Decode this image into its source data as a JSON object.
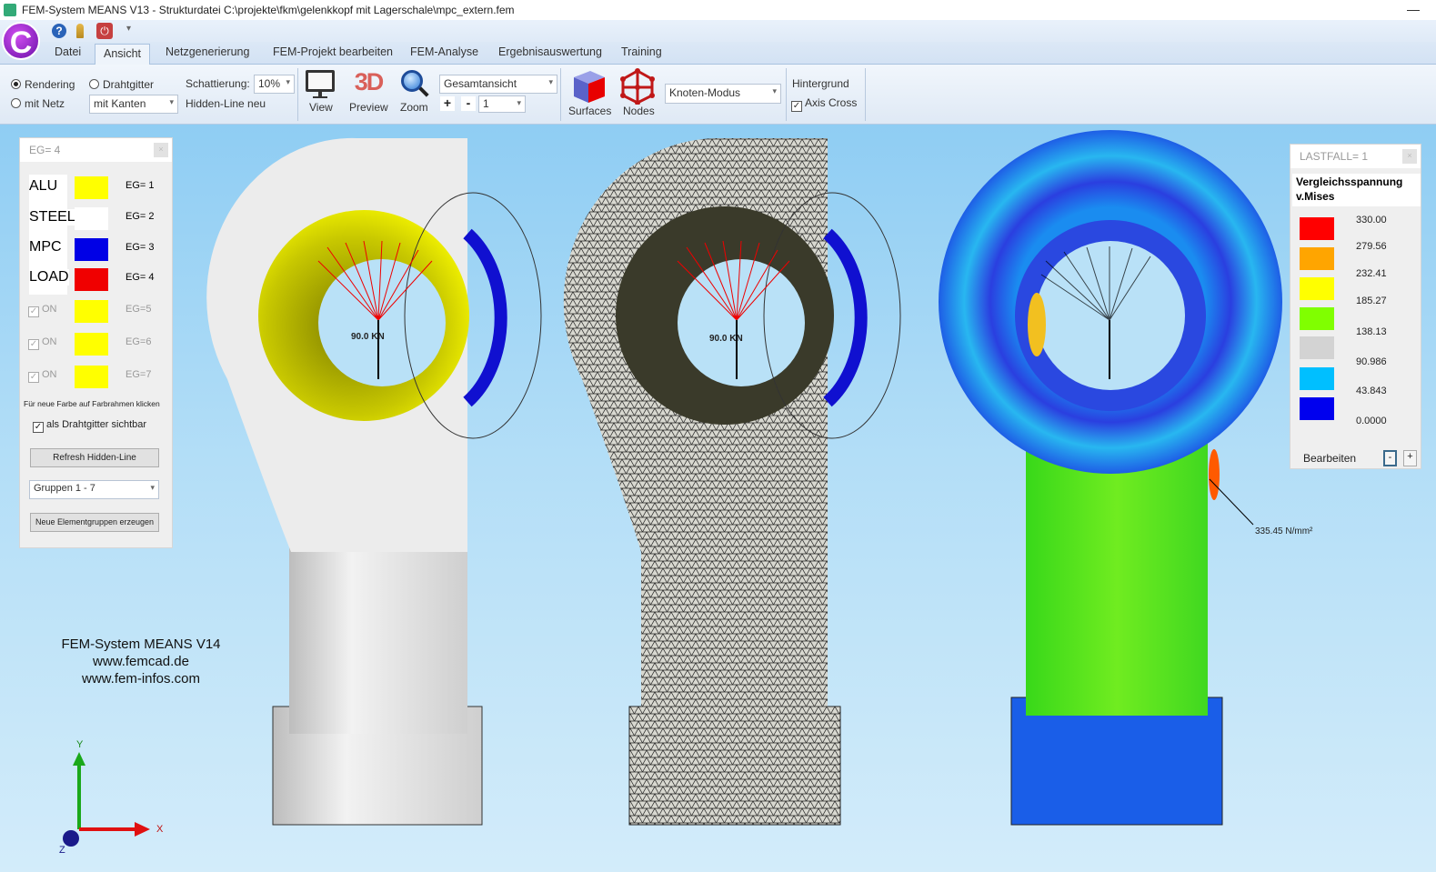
{
  "window": {
    "title": "FEM-System MEANS V13 - Strukturdatei C:\\projekte\\fkm\\gelenkkopf mit Lagerschale\\mpc_extern.fem",
    "minimize": "—"
  },
  "quick_access": {
    "logo": "C",
    "icons": [
      "help-icon",
      "key-icon",
      "power-icon"
    ],
    "more": "▾"
  },
  "tabs": [
    "Datei",
    "Ansicht",
    "Netzgenerierung",
    "FEM-Projekt bearbeiten",
    "FEM-Analyse",
    "Ergebnisauswertung",
    "Training"
  ],
  "active_tab": "Ansicht",
  "ribbon": {
    "rendering": "Rendering",
    "drahtgitter": "Drahtgitter",
    "mit_netz": "mit Netz",
    "kanten": "mit Kanten",
    "schattierung_label": "Schattierung:",
    "schattierung_value": "10%",
    "hidden_line": "Hidden-Line neu",
    "view": "View",
    "preview": "Preview",
    "zoom": "Zoom",
    "preview_icon_text": "3D",
    "ansicht": "Gesamtansicht",
    "plus": "+",
    "minus": "-",
    "step": "1",
    "surfaces": "Surfaces",
    "nodes": "Nodes",
    "modus": "Knoten-Modus",
    "hintergrund": "Hintergrund",
    "axis_cross": "Axis Cross",
    "axis_cross_checked": true
  },
  "eg_panel": {
    "title": "EG=  4",
    "close": "×",
    "groups": [
      {
        "name": "ALU",
        "eg": "EG= 1",
        "color": "#ffff00"
      },
      {
        "name": "STEEL",
        "eg": "EG= 2",
        "color": "#ffffff"
      },
      {
        "name": "MPC",
        "eg": "EG= 3",
        "color": "#0000e6"
      },
      {
        "name": "LOAD",
        "eg": "EG= 4",
        "color": "#f00000"
      },
      {
        "name": "ON",
        "eg": "EG=5",
        "color": "#ffff00"
      },
      {
        "name": "ON",
        "eg": "EG=6",
        "color": "#ffff00"
      },
      {
        "name": "ON",
        "eg": "EG=7",
        "color": "#ffff00"
      }
    ],
    "hint": "Für neue Farbe auf Farbrahmen klicken",
    "wire_visible": "als Drahtgitter sichtbar",
    "refresh": "Refresh Hidden-Line",
    "groups_select": "Gruppen  1 -  7",
    "create": "Neue Elementgruppen erzeugen"
  },
  "legend_panel": {
    "title": "LASTFALL=  1",
    "close": "×",
    "heading1": "Vergleichsspannung",
    "heading2": "v.Mises",
    "colors": [
      "#ff0000",
      "#ffa500",
      "#ffff00",
      "#80ff00",
      "#d3d3d3",
      "#00bfff",
      "#0000ee"
    ],
    "values": [
      "330.00",
      "279.56",
      "232.41",
      "185.27",
      "138.13",
      "90.986",
      "43.843",
      "0.0000"
    ],
    "edit": "Bearbeiten",
    "minus": "-",
    "plus": "+"
  },
  "viewport": {
    "load_label_1": "90.0 KN",
    "load_label_2": "90.0 KN",
    "max_stress": "335.45 N/mm²",
    "watermark": [
      "FEM-System MEANS V14",
      "www.femcad.de",
      "www.fem-infos.com"
    ],
    "axes": {
      "x": "X",
      "y": "Y",
      "z": "Z"
    }
  }
}
